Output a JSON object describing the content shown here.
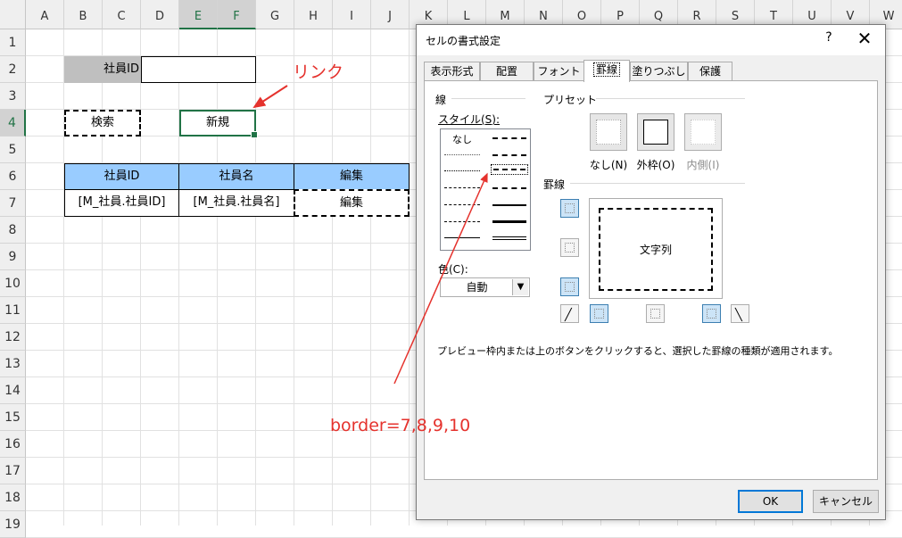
{
  "sheet": {
    "columns": [
      "A",
      "B",
      "C",
      "D",
      "E",
      "F",
      "G",
      "H",
      "I",
      "J",
      "K",
      "L",
      "M",
      "N",
      "O",
      "P",
      "Q",
      "R",
      "S",
      "T",
      "U",
      "V",
      "W"
    ],
    "rows": [
      "1",
      "2",
      "3",
      "4",
      "5",
      "6",
      "7",
      "8",
      "9",
      "10",
      "11",
      "12",
      "13",
      "14",
      "15",
      "16",
      "17",
      "18",
      "19"
    ],
    "employee_id_label": "社員ID",
    "employee_id_value": "",
    "search_button": "検索",
    "new_button": "新規",
    "table_headers": [
      "社員ID",
      "社員名",
      "編集"
    ],
    "table_row": [
      "[M_社員.社員ID]",
      "[M_社員.社員名]",
      "編集"
    ]
  },
  "annotations": {
    "link_label": "リンク",
    "border_label": "border=7,8,9,10"
  },
  "dialog": {
    "title": "セルの書式設定",
    "help": "?",
    "close": "✕",
    "tabs": [
      "表示形式",
      "配置",
      "フォント",
      "罫線",
      "塗りつぶし",
      "保護"
    ],
    "active_tab": "罫線",
    "line_group": "線",
    "style_label": "スタイル(S):",
    "style_none": "なし",
    "color_label": "色(C):",
    "color_value": "自動",
    "preset_group": "プリセット",
    "presets": [
      "なし(N)",
      "外枠(O)",
      "内側(I)"
    ],
    "border_group": "罫線",
    "preview_text": "文字列",
    "note": "プレビュー枠内または上のボタンをクリックすると、選択した罫線の種類が適用されます。",
    "ok": "OK",
    "cancel": "キャンセル"
  },
  "colors": {
    "accent": "#217346",
    "header_fill": "#99ccff",
    "annotation": "#e5322d",
    "selection": "#0078d7"
  }
}
